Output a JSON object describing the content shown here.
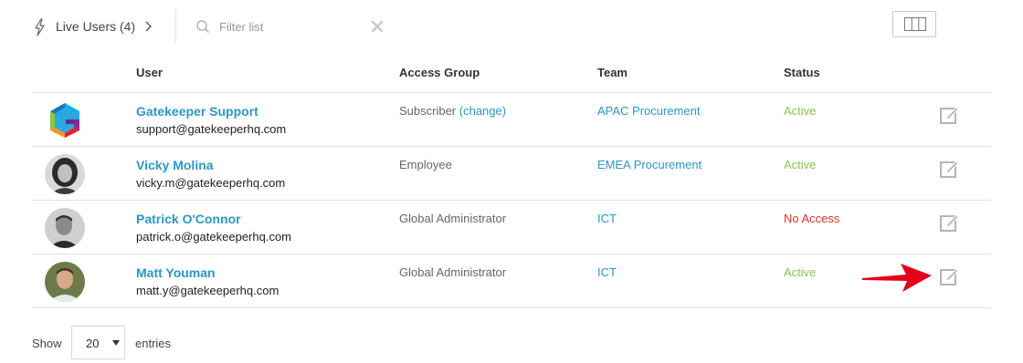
{
  "toolbar": {
    "live_users_label": "Live Users (4)",
    "filter_placeholder": "Filter list",
    "filter_value": "",
    "icons": {
      "live": "lightning-bolt-icon",
      "chevron": "chevron-right-icon",
      "search": "search-icon",
      "clear": "close-icon",
      "columns": "columns-icon"
    }
  },
  "table": {
    "headers": {
      "user": "User",
      "access_group": "Access Group",
      "team": "Team",
      "status": "Status"
    },
    "rows": [
      {
        "name": "Gatekeeper Support",
        "email": "support@gatekeeperhq.com",
        "access_group": "Subscriber",
        "change_link": "(change)",
        "team": "APAC Procurement",
        "status": "Active",
        "status_color": "#8cc152",
        "avatar": "gatekeeper-logo"
      },
      {
        "name": "Vicky Molina",
        "email": "vicky.m@gatekeeperhq.com",
        "access_group": "Employee",
        "team": "EMEA Procurement",
        "status": "Active",
        "status_color": "#8cc152",
        "avatar": "user-photo"
      },
      {
        "name": "Patrick O'Connor",
        "email": "patrick.o@gatekeeperhq.com",
        "access_group": "Global Administrator",
        "team": "ICT",
        "status": "No Access",
        "status_color": "#d9342b",
        "avatar": "user-photo"
      },
      {
        "name": "Matt Youman",
        "email": "matt.y@gatekeeperhq.com",
        "access_group": "Global Administrator",
        "team": "ICT",
        "status": "Active",
        "status_color": "#8cc152",
        "avatar": "user-photo"
      }
    ],
    "edit_icon": "edit-icon"
  },
  "annotation": {
    "arrow": "red-arrow-icon",
    "color": "#e3001b"
  },
  "footer": {
    "show_label": "Show",
    "entries_value": "20",
    "entries_label": "entries"
  },
  "colors": {
    "link": "#2a97c9",
    "active": "#8cc152",
    "no_access": "#d9342b"
  }
}
